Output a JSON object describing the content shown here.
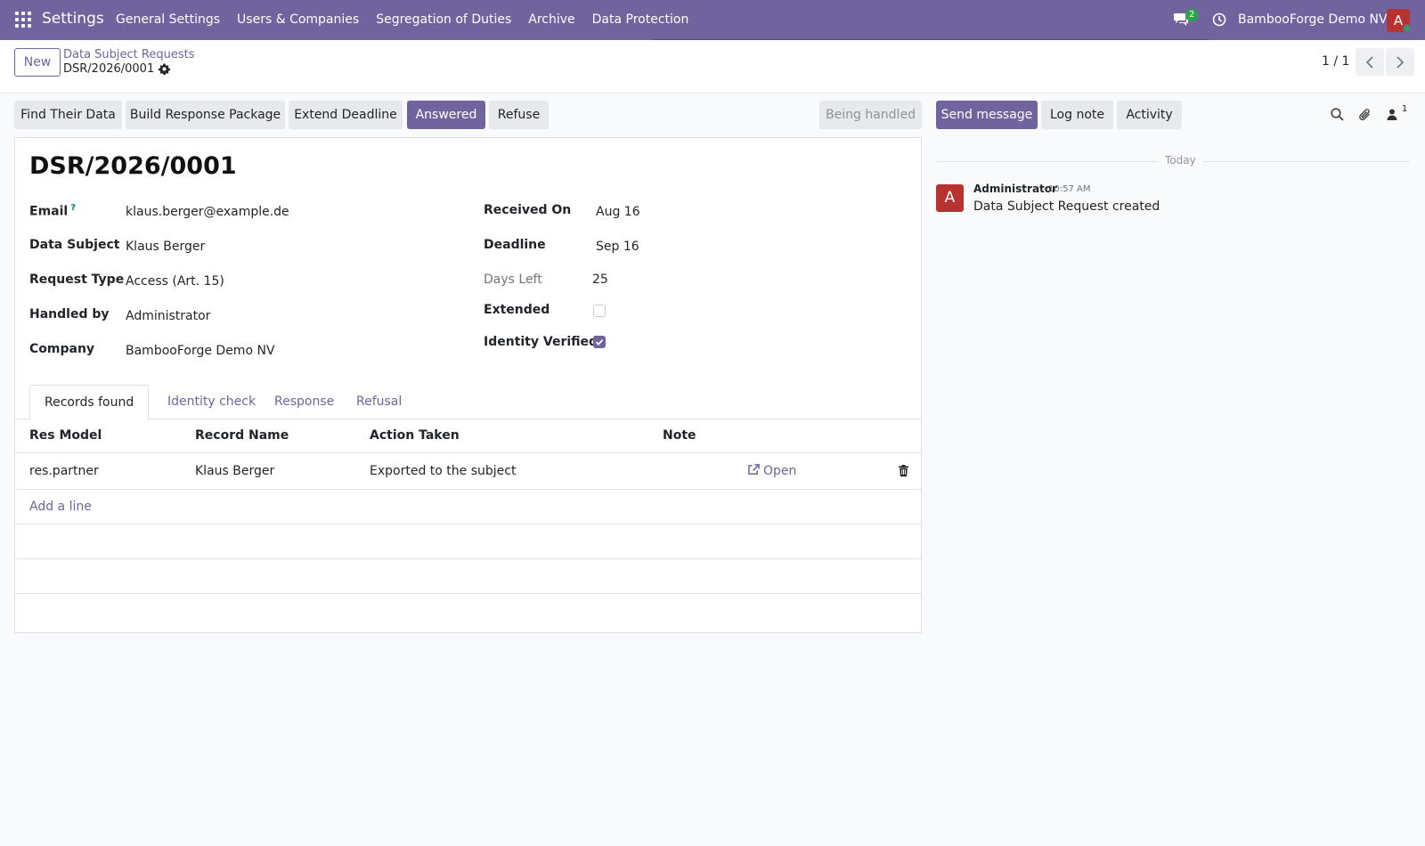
{
  "navbar": {
    "app_name": "Settings",
    "menu": [
      "General Settings",
      "Users & Companies",
      "Segregation of Duties",
      "Archive",
      "Data Protection"
    ],
    "messages_badge": "2",
    "company": "BambooForge Demo NV",
    "avatar_letter": "A",
    "accent_color": "#71639e"
  },
  "control_panel": {
    "new_label": "New",
    "breadcrumb_parent": "Data Subject Requests",
    "breadcrumb_current": "DSR/2026/0001",
    "pager": "1 / 1"
  },
  "actions": {
    "find_data": "Find Their Data",
    "build_package": "Build Response Package",
    "extend_deadline": "Extend Deadline",
    "answered": "Answered",
    "refuse": "Refuse",
    "status": "Being handled"
  },
  "form": {
    "title": "DSR/2026/0001",
    "left_fields": [
      {
        "label": "Email",
        "help": "?",
        "value": "klaus.berger@example.de"
      },
      {
        "label": "Data Subject",
        "value": "Klaus Berger"
      },
      {
        "label": "Request Type",
        "value": "Access (Art. 15)"
      },
      {
        "label": "Handled by",
        "value": "Administrator"
      },
      {
        "label": "Company",
        "value": "BambooForge Demo NV"
      }
    ],
    "right_fields": [
      {
        "label": "Received On",
        "value": "Aug 16"
      },
      {
        "label": "Deadline",
        "value": "Sep 16"
      },
      {
        "label": "Days Left",
        "value": "25"
      },
      {
        "label": "Extended",
        "checked": false
      },
      {
        "label": "Identity Verified",
        "checked": true
      }
    ],
    "tabs": [
      "Records found",
      "Identity check",
      "Response",
      "Refusal"
    ],
    "table": {
      "columns": [
        "Res Model",
        "Record Name",
        "Action Taken",
        "Note"
      ],
      "rows": [
        {
          "res_model": "res.partner",
          "record_name": "Klaus Berger",
          "action_taken": "Exported to the subject",
          "note": "",
          "open_label": "Open"
        }
      ],
      "add_line": "Add a line"
    }
  },
  "chatter": {
    "send_message": "Send message",
    "log_note": "Log note",
    "activity": "Activity",
    "followers_count": "1",
    "date_separator": "Today",
    "messages": [
      {
        "avatar": "A",
        "author": "Administrator",
        "time": "10:57 AM",
        "body": "Data Subject Request created"
      }
    ]
  }
}
